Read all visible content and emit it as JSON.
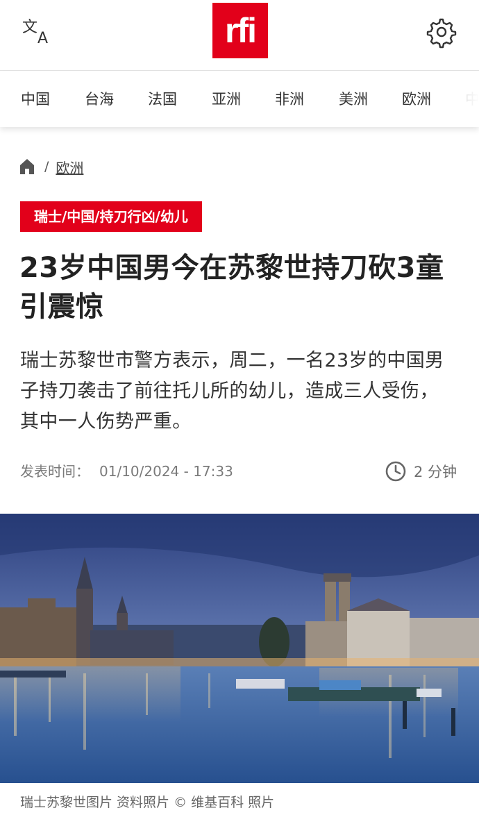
{
  "header": {
    "translate_icon": "translate-icon",
    "logo_text": "rfi",
    "settings_icon": "gear-icon",
    "brand_color": "#e2001a"
  },
  "nav": {
    "items": [
      "中国",
      "台海",
      "法国",
      "亚洲",
      "非洲",
      "美洲",
      "欧洲",
      "中"
    ]
  },
  "breadcrumb": {
    "home_icon": "home-icon",
    "separator": "/",
    "section": "欧洲"
  },
  "article": {
    "tag": "瑞士/中国/持刀行凶/幼儿",
    "title": "23岁中国男今在苏黎世持刀砍3童引震惊",
    "lead": "瑞士苏黎世市警方表示，周二，一名23岁的中国男子持刀袭击了前往托儿所的幼儿，造成三人受伤，其中一人伤势严重。",
    "published_label": "发表时间：",
    "published_value": "01/10/2024 - 17:33",
    "read_time": "2 分钟",
    "read_time_icon": "clock-icon"
  },
  "photo": {
    "caption": "瑞士苏黎世图片 资料照片 © 维基百科 照片"
  }
}
